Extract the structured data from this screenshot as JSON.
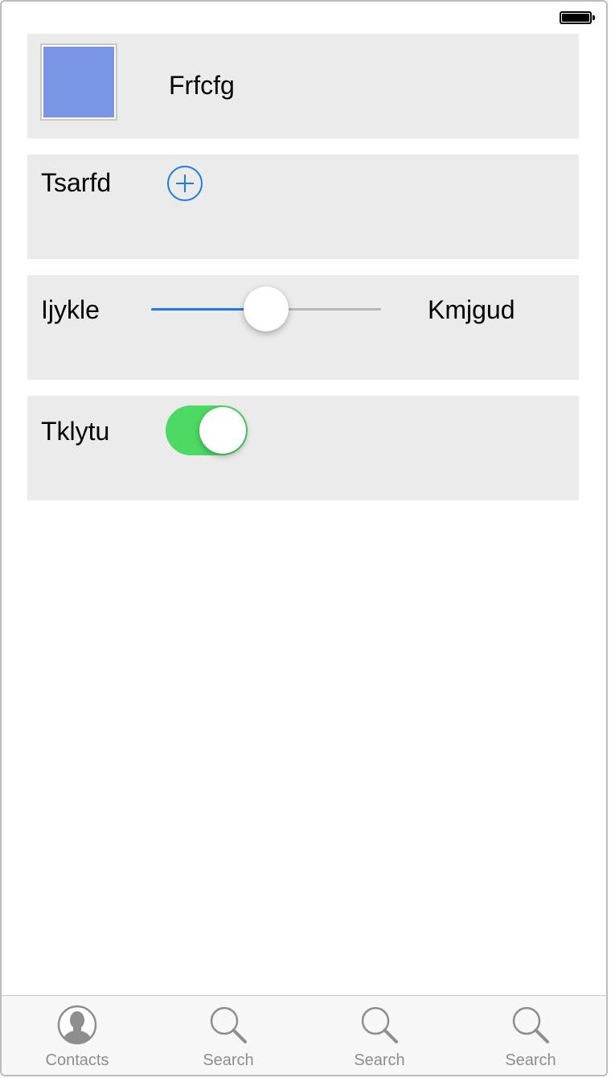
{
  "status_bar": {
    "battery_icon": "battery-full-icon"
  },
  "rows": {
    "color_row": {
      "label": "Frfcfg",
      "swatch_color": "#7b95e6"
    },
    "add_row": {
      "label": "Tsarfd",
      "button_icon": "plus-circle-icon"
    },
    "slider_row": {
      "left_label": "Ijykle",
      "right_label": "Kmjgud",
      "value": 0.5
    },
    "toggle_row": {
      "label": "Tklytu",
      "on": true
    }
  },
  "tab_bar": {
    "items": [
      {
        "label": "Contacts",
        "icon": "contacts-icon"
      },
      {
        "label": "Search",
        "icon": "search-icon"
      },
      {
        "label": "Search",
        "icon": "search-icon"
      },
      {
        "label": "Search",
        "icon": "search-icon"
      }
    ]
  },
  "colors": {
    "accent": "#1a7cf0",
    "toggle_on": "#4cd964",
    "row_background": "#ebebeb",
    "tab_inactive": "#8e8e8e"
  }
}
